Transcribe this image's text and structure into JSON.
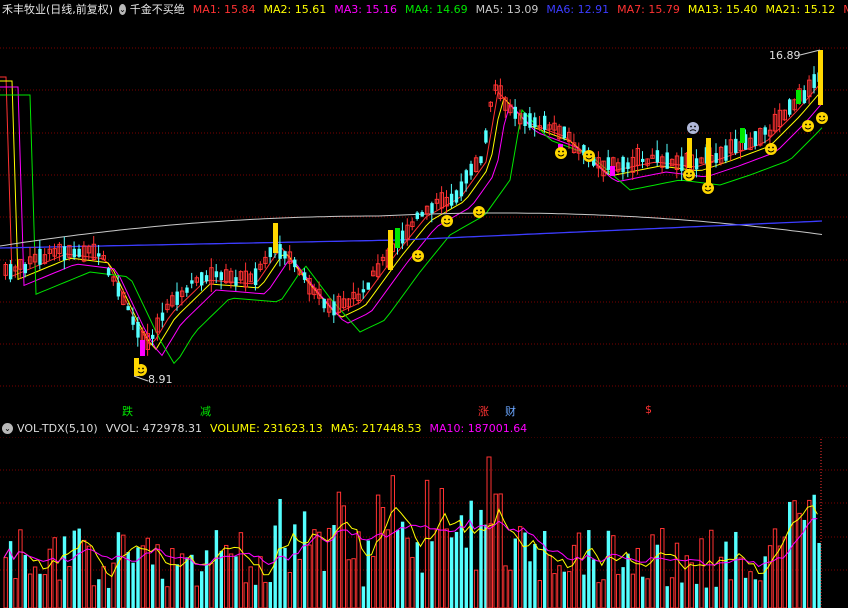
{
  "header": {
    "stock_title": "禾丰牧业(日线,前复权)",
    "indicator_name": "千金不买绝",
    "ma_values": [
      {
        "label": "MA1: 15.84",
        "color": "#ff3232"
      },
      {
        "label": "MA2: 15.61",
        "color": "#ffff00"
      },
      {
        "label": "MA3: 15.16",
        "color": "#ff00ff"
      },
      {
        "label": "MA4: 14.69",
        "color": "#00e600"
      },
      {
        "label": "MA5: 13.09",
        "color": "#c8c8c8"
      },
      {
        "label": "MA6: 12.91",
        "color": "#3c3cff"
      },
      {
        "label": "MA7: 15.79",
        "color": "#ff3232"
      },
      {
        "label": "MA13: 15.40",
        "color": "#ffff00"
      },
      {
        "label": "MA21: 15.12",
        "color": "#ffff00"
      }
    ],
    "more_label": "M"
  },
  "price_chart": {
    "high_label": "16.89",
    "low_label": "8.91",
    "signals": [
      {
        "text": "跌",
        "color": "#00e600"
      },
      {
        "text": "减",
        "color": "#00e600"
      },
      {
        "text": "涨",
        "color": "#ff3232"
      },
      {
        "text": "财",
        "color": "#6aa6ff"
      },
      {
        "text": "$",
        "color": "#ff3232"
      }
    ]
  },
  "volume_header": {
    "name": "VOL-TDX(5,10)",
    "vvol": "VVOL: 472978.31",
    "volume": "VOLUME: 231623.13",
    "ma5": "MA5: 217448.53",
    "ma10": "MA10: 187001.64",
    "colors": {
      "name": "#dcdcdc",
      "vvol": "#dcdcdc",
      "volume": "#ffff00",
      "ma5": "#ffff00",
      "ma10": "#ff00ff"
    }
  },
  "colors": {
    "up": "#ff3232",
    "down": "#54ffff",
    "grid": "#7a0000",
    "ma_white": "#c8c8c8",
    "ma_blue": "#3c3cff"
  }
}
